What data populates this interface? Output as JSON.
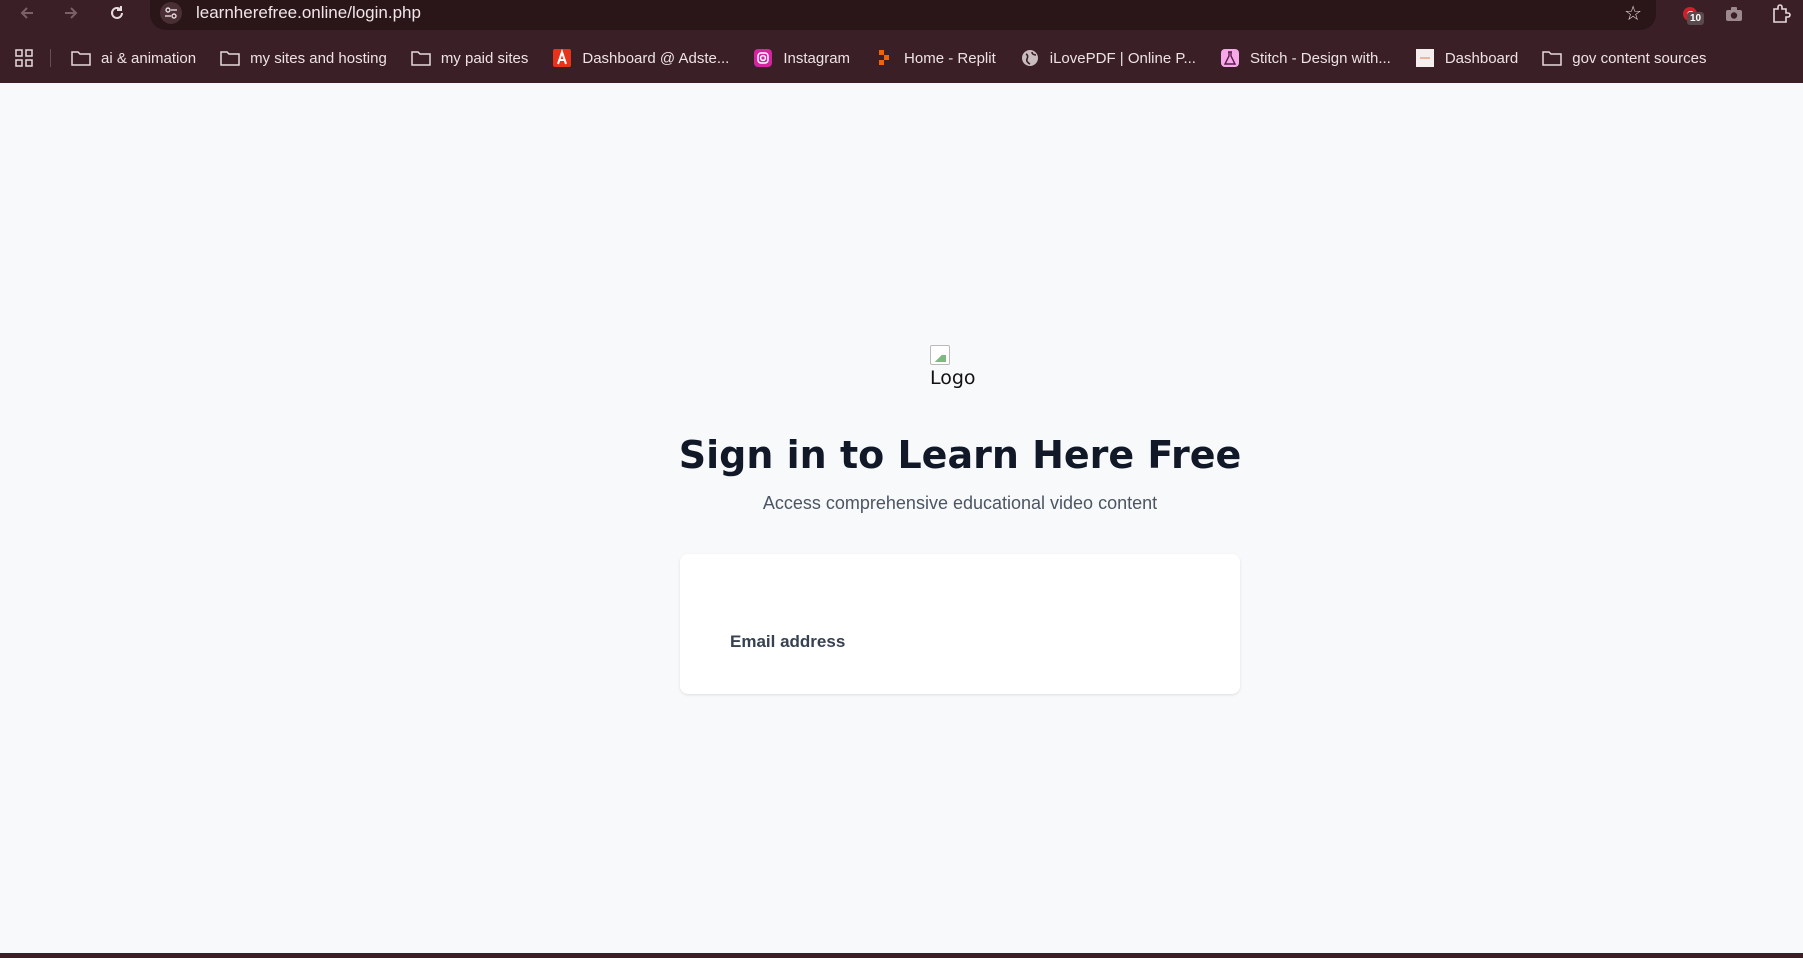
{
  "browser": {
    "url": "learnherefree.online/login.php",
    "extension_badge": "10",
    "bookmarks": [
      {
        "label": "ai & animation",
        "icon": "folder-icon"
      },
      {
        "label": "my sites and hosting",
        "icon": "folder-icon"
      },
      {
        "label": "my paid sites",
        "icon": "folder-icon"
      },
      {
        "label": "Dashboard @ Adste...",
        "icon": "adsterra-icon"
      },
      {
        "label": "Instagram",
        "icon": "instagram-icon"
      },
      {
        "label": "Home - Replit",
        "icon": "replit-icon"
      },
      {
        "label": "iLovePDF | Online P...",
        "icon": "globe-icon"
      },
      {
        "label": "Stitch - Design with...",
        "icon": "stitch-icon"
      },
      {
        "label": "Dashboard",
        "icon": "dashboard-icon"
      },
      {
        "label": "gov content sources",
        "icon": "folder-icon"
      }
    ]
  },
  "page": {
    "logo_alt": "Logo",
    "heading": "Sign in to Learn Here Free",
    "subheading": "Access comprehensive educational video content",
    "form": {
      "email_label": "Email address"
    }
  },
  "colors": {
    "chrome": "#3b1f26",
    "page_bg": "#f8f9fb",
    "heading": "#111827"
  }
}
